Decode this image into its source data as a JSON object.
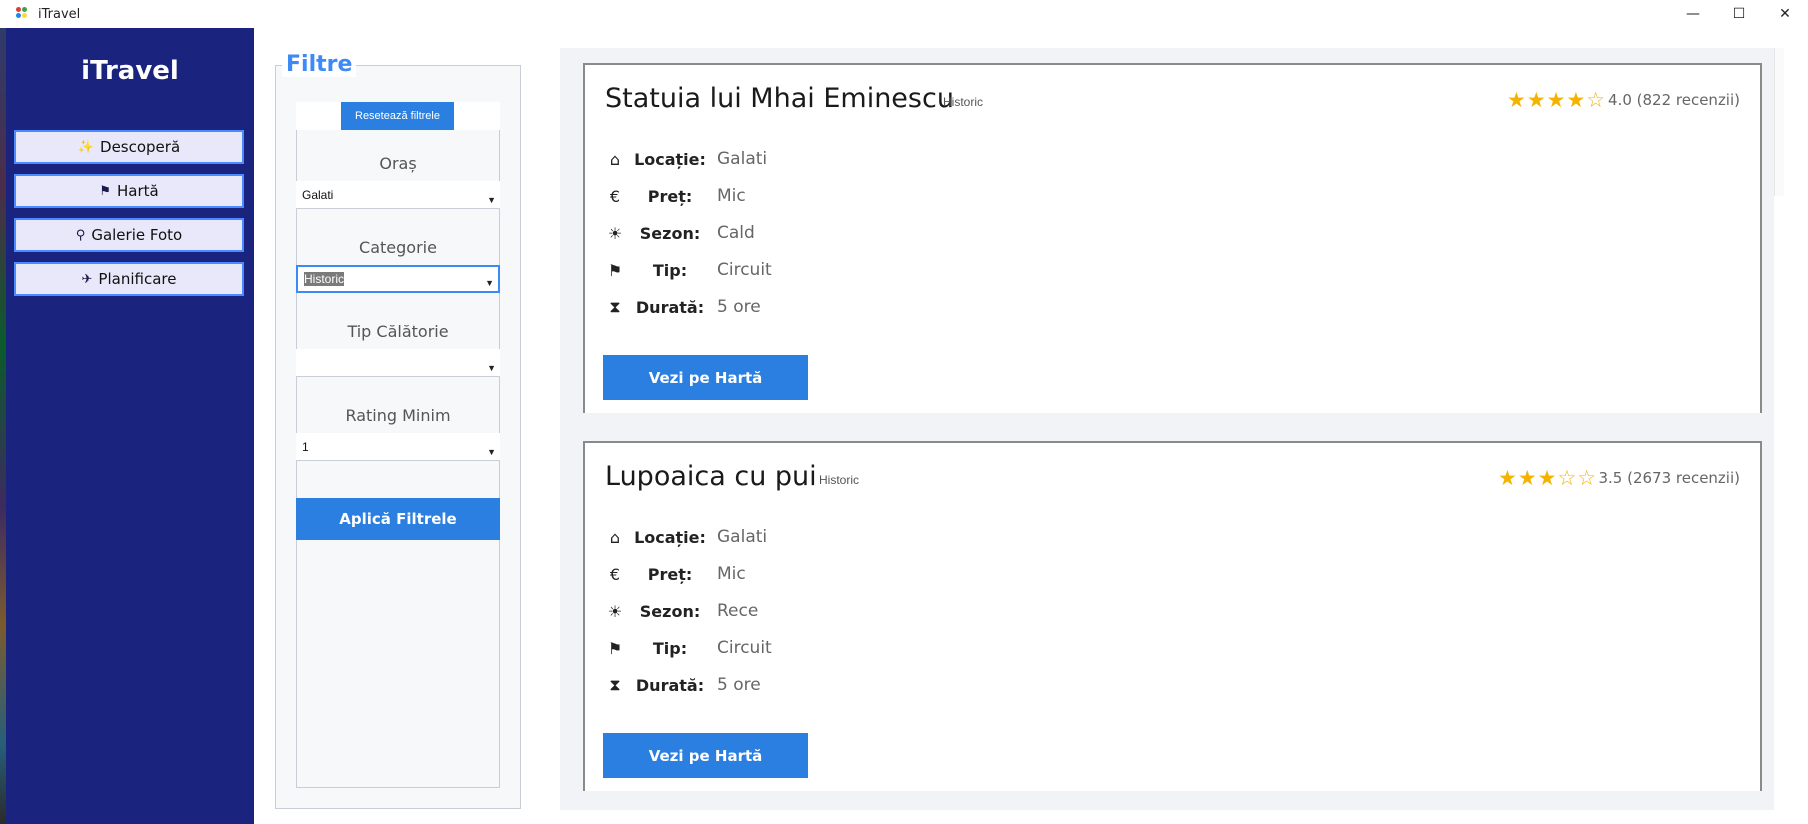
{
  "window": {
    "title": "iTravel",
    "icon": "app-logo-icon",
    "controls": {
      "minimize": "—",
      "maximize": "☐",
      "close": "✕"
    }
  },
  "sidebar": {
    "brand": "iTravel",
    "items": [
      {
        "label": "Descoperă",
        "icon": "sparkle-icon",
        "glyph": "✨"
      },
      {
        "label": "Hartă",
        "icon": "flag-icon",
        "glyph": "⚑"
      },
      {
        "label": "Galerie Foto",
        "icon": "search-icon",
        "glyph": "⚲"
      },
      {
        "label": "Planificare",
        "icon": "plane-icon",
        "glyph": "✈"
      }
    ]
  },
  "filters": {
    "title": "Filtre",
    "reset_label": "Resetează filtrele",
    "city_label": "Oraș",
    "city_value": "Galati",
    "category_label": "Categorie",
    "category_value": "Historic",
    "travel_type_label": "Tip Călătorie",
    "travel_type_value": "",
    "rating_label": "Rating Minim",
    "rating_value": "1",
    "apply_label": "Aplică Filtrele"
  },
  "results": [
    {
      "name": "Statuia lui Mhai Eminescu",
      "category": "Historic",
      "stars": "★★★★☆",
      "rating": 4.0,
      "rating_text": "4.0 (822 recenzii)",
      "location_label": "Locație:",
      "location": "Galati",
      "price_label": "Preț:",
      "price": "Mic",
      "season_label": "Sezon:",
      "season": "Cald",
      "type_label": "Tip:",
      "type": "Circuit",
      "duration_label": "Durată:",
      "duration": "5 ore",
      "map_button": "Vezi pe Hartă"
    },
    {
      "name": "Lupoaica cu pui",
      "category": "Historic",
      "stars": "★★★☆☆",
      "rating": 3.5,
      "rating_text": "3.5 (2673 recenzii)",
      "location_label": "Locație:",
      "location": "Galati",
      "price_label": "Preț:",
      "price": "Mic",
      "season_label": "Sezon:",
      "season": "Rece",
      "type_label": "Tip:",
      "type": "Circuit",
      "duration_label": "Durată:",
      "duration": "5 ore",
      "map_button": "Vezi pe Hartă"
    }
  ],
  "icons": {
    "location": "⌂",
    "price": "€",
    "season": "☀",
    "type": "⚑",
    "duration": "⧗",
    "caret": "▼"
  },
  "colors": {
    "sidebar": "#1a237e",
    "accent": "#2a7fe0",
    "title_accent": "#3d8af7",
    "star": "#f5b301"
  }
}
